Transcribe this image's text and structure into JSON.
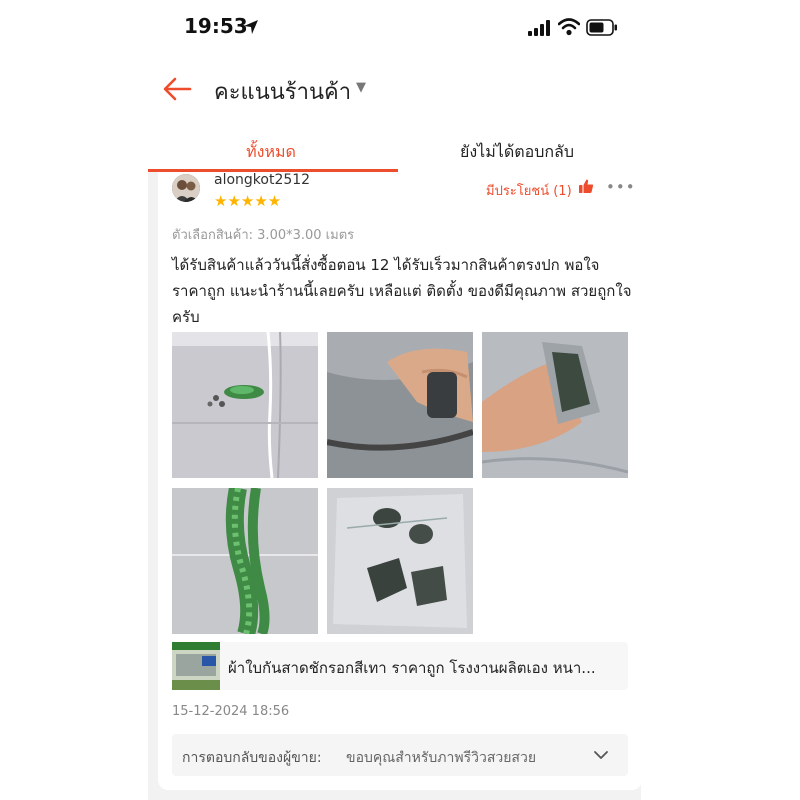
{
  "status_bar": {
    "time": "19:53"
  },
  "header": {
    "title": "คะแนนร้านค้า"
  },
  "tabs": [
    {
      "label": "ทั้งหมด",
      "active": true
    },
    {
      "label": "ยังไม่ได้ตอบกลับ",
      "active": false
    }
  ],
  "review": {
    "username": "alongkot2512",
    "stars": "★★★★★",
    "rating": 5,
    "helpful": "มีประโยชน์ (1)",
    "variation": "ตัวเลือกสินค้า: 3.00*3.00 เมตร",
    "text": "ได้รับสินค้าแล้ววันนี้สั่งซื้อตอน 12 ได้รับเร็วมากสินค้าตรงปก พอใจราคาถูก แนะนำร้านนี้เลยครับ เหลือแต่ ติดตั้ง ของดีมีคุณภาพ สวยถูกใจครับ",
    "photos": [
      "grey tarp with green rope and hardware",
      "hand holding grey tarp edge",
      "hand holding folded tarp hem",
      "green rope bundle on tarp",
      "bagged metal clamps"
    ],
    "product_name": "ผ้าใบกันสาดชักรอกสีเทา ราคาถูก โรงงานผลิตเอง หนา...",
    "date": "15-12-2024 18:56",
    "seller_reply_label": "การตอบกลับของผู้ขาย:",
    "seller_reply_text": "ขอบคุณสำหรับภาพรีวิวสวยสวย"
  },
  "colors": {
    "accent": "#ee4d2d",
    "star": "#ffb400"
  }
}
